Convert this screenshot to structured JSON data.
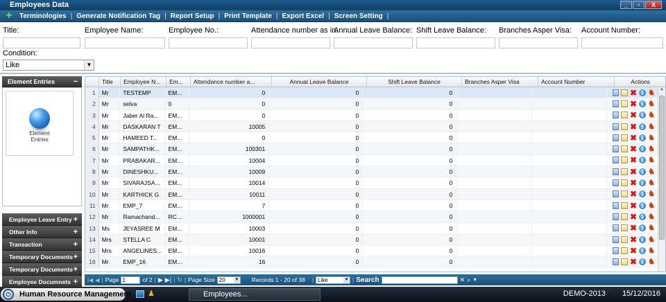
{
  "window": {
    "title": "Employees Data",
    "controls": [
      "_",
      "▫",
      "X"
    ]
  },
  "toolbar": {
    "items": [
      "Terminologies",
      "Generate Notification Tag",
      "Report Setup",
      "Print Template",
      "Export Excel",
      "Screen Setting"
    ]
  },
  "filters": {
    "labels": [
      "Title:",
      "Employee Name:",
      "Employee No.:",
      "Attendance number as in:",
      "Annual Leave Balance:",
      "Shift Leave Balance:",
      "Branches Asper Visa:",
      "Account Number:"
    ],
    "condition_label": "Condition:",
    "condition_value": "Like"
  },
  "left_panel": {
    "header": "Element Entries",
    "tile_label_line1": "Element",
    "tile_label_line2": "Entries",
    "groups": [
      "Employee Leave Entry",
      "Other Info",
      "Transaction",
      "Temporary Documents",
      "Temporary Documents",
      "Employee Documnets"
    ]
  },
  "grid": {
    "headers": [
      "",
      "Title",
      "Employee N...",
      "Em...",
      "Attendance number a...",
      "Annual Leave Balance",
      "Shift Leave Balance",
      "Branches Asper Visa",
      "Account Number",
      "Actions"
    ],
    "rows": [
      {
        "n": "1",
        "title": "Mr",
        "name": "TESTEMP",
        "emp": "EM...",
        "att": "0",
        "annual": "0",
        "shift": "0"
      },
      {
        "n": "2",
        "title": "Mr",
        "name": "selva",
        "emp": "0",
        "att": "0",
        "annual": "0",
        "shift": "0"
      },
      {
        "n": "3",
        "title": "Mr",
        "name": "Jaber Al Ra...",
        "emp": "EM...",
        "att": "0",
        "annual": "0",
        "shift": "0"
      },
      {
        "n": "4",
        "title": "Mr",
        "name": "DASKARAN T",
        "emp": "EM...",
        "att": "10005",
        "annual": "0",
        "shift": "0"
      },
      {
        "n": "5",
        "title": "Mr",
        "name": "HAMEED T...",
        "emp": "EM...",
        "att": "0",
        "annual": "0",
        "shift": "0"
      },
      {
        "n": "6",
        "title": "Mr",
        "name": "SAMPATHK...",
        "emp": "EM...",
        "att": "100301",
        "annual": "0",
        "shift": "0"
      },
      {
        "n": "7",
        "title": "Mr",
        "name": "PRABAKAR...",
        "emp": "EM...",
        "att": "10004",
        "annual": "0",
        "shift": "0"
      },
      {
        "n": "8",
        "title": "Mr",
        "name": "DINESHKU...",
        "emp": "EM...",
        "att": "10009",
        "annual": "0",
        "shift": "0"
      },
      {
        "n": "9",
        "title": "Mr",
        "name": "SIVARAJSA...",
        "emp": "EM...",
        "att": "10014",
        "annual": "0",
        "shift": "0"
      },
      {
        "n": "10",
        "title": "Mr",
        "name": "KARTHICK G",
        "emp": "EM...",
        "att": "10011",
        "annual": "0",
        "shift": "0"
      },
      {
        "n": "11",
        "title": "Mr",
        "name": "EMP_7",
        "emp": "EM...",
        "att": "7",
        "annual": "0",
        "shift": "0"
      },
      {
        "n": "12",
        "title": "Mr",
        "name": "Ramachand...",
        "emp": "RC...",
        "att": "1000001",
        "annual": "0",
        "shift": "0"
      },
      {
        "n": "13",
        "title": "Ms",
        "name": "JEYASREE M",
        "emp": "EM...",
        "att": "10003",
        "annual": "0",
        "shift": "0"
      },
      {
        "n": "14",
        "title": "Mrs",
        "name": "STELLA C",
        "emp": "EM...",
        "att": "10001",
        "annual": "0",
        "shift": "0"
      },
      {
        "n": "15",
        "title": "Mrs",
        "name": "ANGELINES...",
        "emp": "EM...",
        "att": "10016",
        "annual": "0",
        "shift": "0"
      },
      {
        "n": "16",
        "title": "Mr",
        "name": "EMP_16",
        "emp": "EM...",
        "att": "16",
        "annual": "0",
        "shift": "0"
      }
    ],
    "action_icons": [
      "view-icon",
      "edit-icon",
      "delete-icon",
      "info-icon",
      "employee-icon"
    ]
  },
  "pager": {
    "page_label": "Page",
    "page_value": "1",
    "of_pages": "of 2",
    "page_size_label": "Page Size",
    "page_size_value": "20",
    "records": "Records 1 - 20 of 38",
    "search_mode": "Like",
    "search_label": "Search"
  },
  "taskbar": {
    "app_button": "Human Resource Management",
    "task": "Employees...",
    "company": "DEMO-2013",
    "date": "15/12/2016"
  },
  "colors": {
    "toolbar_blue": "#1b4f78",
    "selected_row": "#dbe8f7",
    "delete_red": "#d21a1a"
  }
}
